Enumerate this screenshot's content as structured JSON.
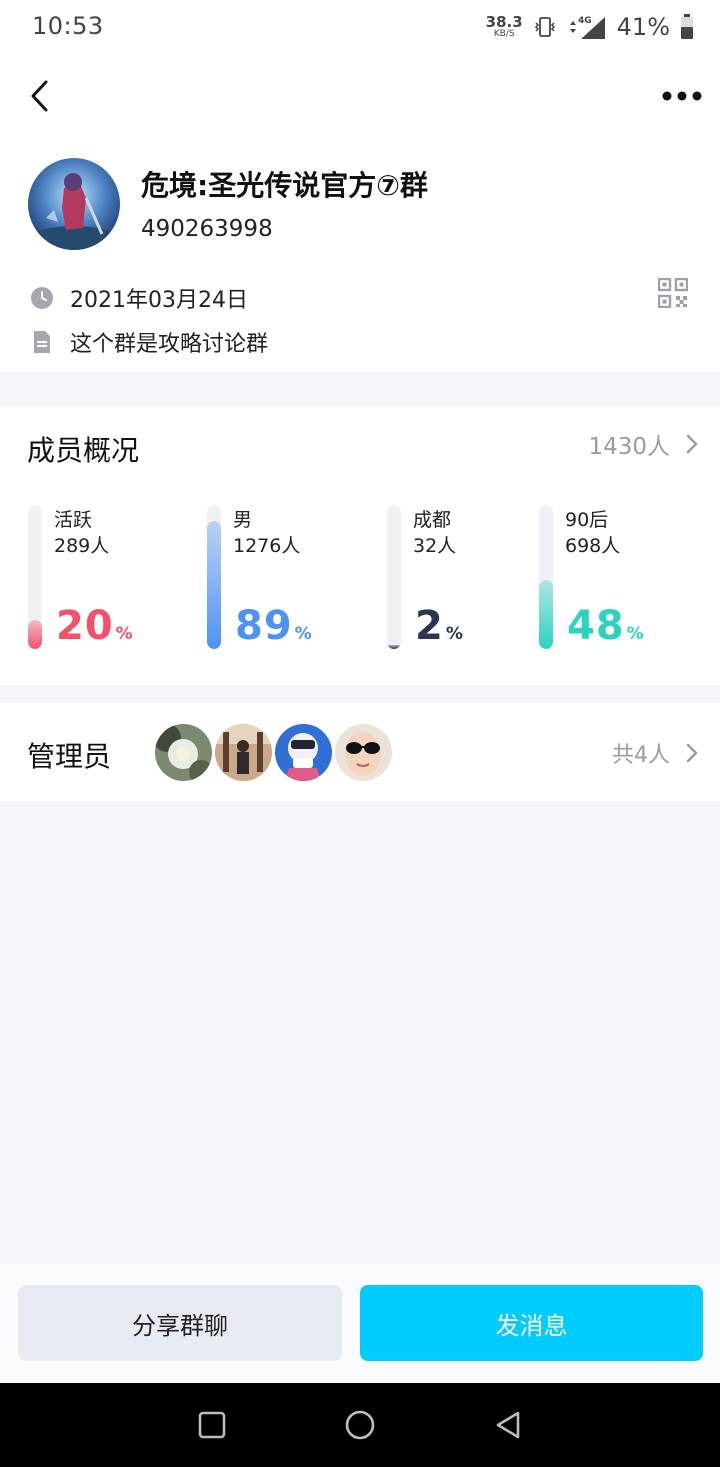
{
  "status_bar": {
    "time": "10:53",
    "net_speed": "38.3",
    "net_unit": "KB/S",
    "network": "4G",
    "battery": "41%"
  },
  "group": {
    "name": "危境:圣光传说官方⑦群",
    "id": "490263998",
    "created_date": "2021年03月24日",
    "description": "这个群是攻略讨论群"
  },
  "members": {
    "title": "成员概况",
    "total": "1430人",
    "stats": [
      {
        "label": "活跃",
        "count": "289人",
        "percent": "20",
        "percent_sign": "%",
        "fraction": 0.2,
        "color": "#f2516a"
      },
      {
        "label": "男",
        "count": "1276人",
        "percent": "89",
        "percent_sign": "%",
        "fraction": 0.89,
        "color": "#4f92f3"
      },
      {
        "label": "成都",
        "count": "32人",
        "percent": "2",
        "percent_sign": "%",
        "fraction": 0.02,
        "color": "#2c3450"
      },
      {
        "label": "90后",
        "count": "698人",
        "percent": "48",
        "percent_sign": "%",
        "fraction": 0.48,
        "color": "#2bd3bf"
      }
    ]
  },
  "admins": {
    "title": "管理员",
    "total": "共4人"
  },
  "actions": {
    "share_label": "分享群聊",
    "send_label": "发消息"
  },
  "icons": {
    "back": "back-arrow-icon",
    "more": "more-dots-icon",
    "clock": "clock-icon",
    "document": "document-icon",
    "qr": "qr-code-icon",
    "chevron": "chevron-right-icon"
  },
  "colors": {
    "accent": "#00ccff",
    "share_bg": "#e8ebf3",
    "page_bg": "#f4f5f9"
  }
}
